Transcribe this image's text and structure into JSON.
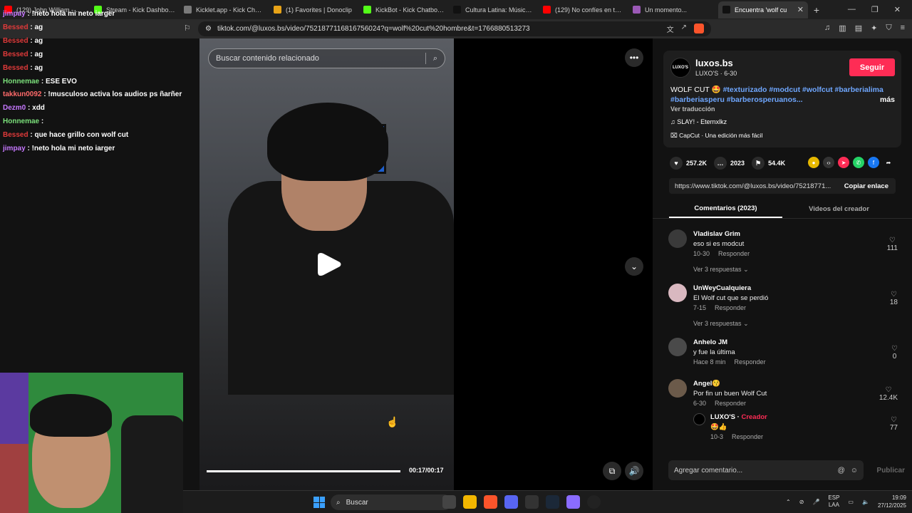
{
  "browser": {
    "tabs": [
      {
        "title": "(129) John William - Some",
        "color": "#ff0000"
      },
      {
        "title": "Stream - Kick Dashboard",
        "color": "#53fc18"
      },
      {
        "title": "Kicklet.app - Kick Chatbot",
        "color": "#7a7a7a"
      },
      {
        "title": "(1) Favorites | Donoclip",
        "color": "#e8a317"
      },
      {
        "title": "KickBot - Kick Chatbot, Ale",
        "color": "#53fc18"
      },
      {
        "title": "Cultura Latina: Música y St",
        "color": "#111111"
      },
      {
        "title": "(129) No confíes en tus he",
        "color": "#ff0000"
      },
      {
        "title": "Un momento...",
        "color": "#9b59b6"
      },
      {
        "title": "Encuentra 'wolf cu",
        "color": "#111111"
      }
    ],
    "new_tab": "+",
    "url": "tiktok.com/@luxos.bs/video/7521877116816756024?q=wolf%20cut%20hombre&t=1766880513273"
  },
  "chat": [
    {
      "user": "jimpay",
      "text": "!neto hola mi neto iarger",
      "color": "#c678ff"
    },
    {
      "user": "Bessed",
      "text": "ag",
      "color": "#e03a3a"
    },
    {
      "user": "Bessed",
      "text": "ag",
      "color": "#e03a3a"
    },
    {
      "user": "Bessed",
      "text": "ag",
      "color": "#e03a3a"
    },
    {
      "user": "Bessed",
      "text": "ag",
      "color": "#e03a3a"
    },
    {
      "user": "Honnemae",
      "text": "ESE EVO",
      "color": "#7be07b"
    },
    {
      "user": "takkun0092",
      "text": "!musculoso activa los audios ps ñarñer",
      "color": "#ff6a6a"
    },
    {
      "user": "Dezm0",
      "text": "xdd",
      "color": "#c678ff"
    },
    {
      "user": "Honnemae",
      "text": "",
      "color": "#7be07b"
    },
    {
      "user": "Bessed",
      "text": "que hace grillo con wolf cut",
      "color": "#e03a3a"
    },
    {
      "user": "jimpay",
      "text": "!neto hola mi neto iarger",
      "color": "#c678ff"
    }
  ],
  "video": {
    "search_placeholder": "Buscar contenido relacionado",
    "time": "00:17/00:17",
    "progress": 1.0
  },
  "creator": {
    "username": "luxos.bs",
    "avatar_text": "LUXO'S",
    "subtitle": "LUXO'S · 6-30",
    "follow": "Seguir",
    "caption_prefix": "WOLF CUT 🤩",
    "tags": [
      "#texturizado",
      "#modcut",
      "#wolfcut",
      "#barberialima",
      "#barberiasperu",
      "#barberosperuanos..."
    ],
    "more": "más",
    "translate": "Ver traducción",
    "music": "SLAY! - Eternxlkz",
    "capcut": "CapCut · Una edición más fácil"
  },
  "stats": {
    "likes": "257.2K",
    "comments": "2023",
    "saves": "54.4K"
  },
  "link": {
    "url": "https://www.tiktok.com/@luxos.bs/video/75218771...",
    "copy": "Copiar enlace"
  },
  "panel_tabs": [
    "Comentarios (2023)",
    "Videos del creador"
  ],
  "comments": [
    {
      "name": "Vladislav Grim",
      "text": "eso si es modcut",
      "date": "10-30",
      "reply": "Responder",
      "likes": "111",
      "more": "Ver 3 respuestas",
      "avatar": "#3a3a3a"
    },
    {
      "name": "UnWeyCualquiera",
      "text": "El Wolf cut que se perdió",
      "date": "7-15",
      "reply": "Responder",
      "likes": "18",
      "more": "Ver 3 respuestas",
      "avatar": "#d9b8c0"
    },
    {
      "name": "Anhelo JM",
      "text": "y fue la última",
      "date": "Hace 8 min",
      "reply": "Responder",
      "likes": "0",
      "more": "",
      "avatar": "#4a4a4a"
    },
    {
      "name": "Angel😚",
      "text": "Por fin un buen Wolf Cut",
      "date": "6-30",
      "reply": "Responder",
      "likes": "12.4K",
      "more": "",
      "avatar": "#6b5a4a"
    }
  ],
  "creator_reply": {
    "name": "LUXO'S",
    "badge": "Creador",
    "text": "🤩👍",
    "date": "10-3",
    "reply": "Responder",
    "likes": "77"
  },
  "composer": {
    "placeholder": "Agregar comentario...",
    "publish": "Publicar"
  },
  "taskbar": {
    "search": "Buscar",
    "lang": "ESP",
    "lang2": "LAA",
    "time": "19:09",
    "date": "27/12/2025"
  }
}
